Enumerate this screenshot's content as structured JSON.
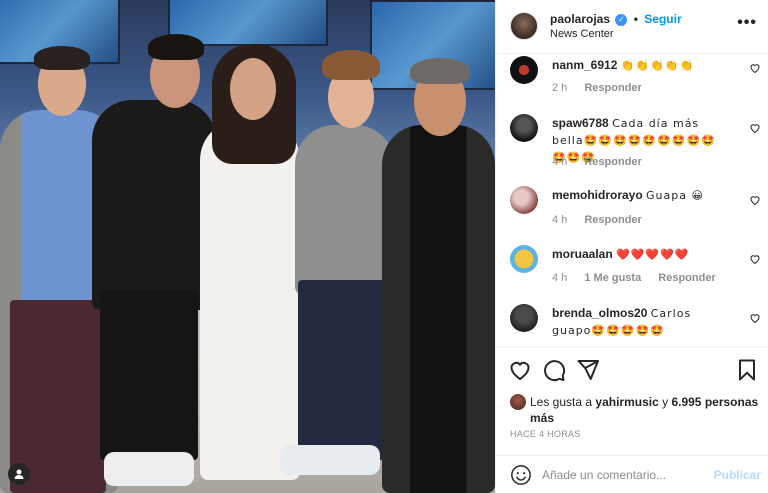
{
  "post": {
    "username": "paolarojas",
    "separator": "•",
    "follow_label": "Seguir",
    "location": "News Center",
    "more_label": "•••"
  },
  "comments": [
    {
      "user": "nanm_6912",
      "text": "👏👏👏👏👏",
      "time": "2 h",
      "likes": "",
      "reply": "Responder"
    },
    {
      "user": "spaw6788",
      "text": "Cada día más bella🤩🤩🤩🤩🤩🤩🤩🤩🤩🤩🤩🤩",
      "time": "4 h",
      "likes": "",
      "reply": "Responder"
    },
    {
      "user": "memohidrorayo",
      "text": "Guapa 😀",
      "time": "4 h",
      "likes": "",
      "reply": "Responder"
    },
    {
      "user": "moruaalan",
      "text": "❤️❤️❤️❤️❤️",
      "time": "4 h",
      "likes": "1 Me gusta",
      "reply": "Responder"
    },
    {
      "user": "brenda_olmos20",
      "text": "Carlos guapo🤩🤩🤩🤩🤩",
      "time": "",
      "likes": "",
      "reply": ""
    }
  ],
  "likes": {
    "prefix": "Les gusta a",
    "liked_by": "yahirmusic",
    "connector": "y",
    "others": "6.995 personas más"
  },
  "time_ago": "HACE 4 HORAS",
  "add_comment": {
    "placeholder": "Añade un comentario...",
    "post_label": "Publicar"
  },
  "colors": {
    "accent": "#0095f6",
    "verified": "#3897f0",
    "muted": "#8e8e8e",
    "post_disabled": "#b3dbff"
  },
  "icons": {
    "like": "heart-icon",
    "comment": "comment-icon",
    "share": "paper-plane-icon",
    "save": "bookmark-icon",
    "emoji": "smiley-icon",
    "more": "more-options-icon",
    "verified": "verified-badge-icon",
    "comment_like": "small-heart-icon",
    "profile_tag": "user-tag-icon"
  }
}
